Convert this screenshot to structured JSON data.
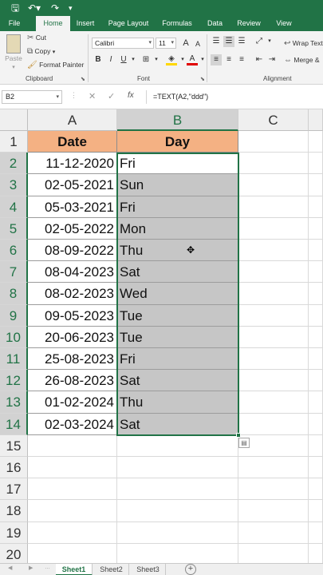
{
  "quick_access": {
    "save_icon": "save-icon",
    "undo_icon": "undo-icon",
    "redo_icon": "redo-icon",
    "customize_icon": "customize-icon"
  },
  "tabs": [
    "File",
    "Home",
    "Insert",
    "Page Layout",
    "Formulas",
    "Data",
    "Review",
    "View"
  ],
  "active_tab": "Home",
  "ribbon": {
    "clipboard": {
      "paste": "Paste",
      "cut": "Cut",
      "copy": "Copy",
      "format_painter": "Format Painter",
      "label": "Clipboard"
    },
    "font": {
      "name": "Calibri",
      "size": "11",
      "label": "Font",
      "bold": "B",
      "italic": "I",
      "underline": "U",
      "grow": "A",
      "shrink": "A",
      "fill_label": "A"
    },
    "alignment": {
      "wrap_text": "Wrap Text",
      "merge": "Merge &",
      "label": "Alignment"
    }
  },
  "formula_bar": {
    "name_box": "B2",
    "formula": "=TEXT(A2,\"ddd\")",
    "fx": "fx",
    "cancel": "✕",
    "enter": "✓"
  },
  "grid": {
    "columns": [
      "A",
      "B",
      "C"
    ],
    "rows": [
      "1",
      "2",
      "3",
      "4",
      "5",
      "6",
      "7",
      "8",
      "9",
      "10",
      "11",
      "12",
      "13",
      "14",
      "15",
      "16",
      "17",
      "18",
      "19",
      "20"
    ],
    "header": [
      "Date",
      "Day"
    ],
    "data": [
      [
        "11-12-2020",
        "Fri"
      ],
      [
        "02-05-2021",
        "Sun"
      ],
      [
        "05-03-2021",
        "Fri"
      ],
      [
        "02-05-2022",
        "Mon"
      ],
      [
        "08-09-2022",
        "Thu"
      ],
      [
        "08-04-2023",
        "Sat"
      ],
      [
        "08-02-2023",
        "Wed"
      ],
      [
        "09-05-2023",
        "Tue"
      ],
      [
        "20-06-2023",
        "Tue"
      ],
      [
        "25-08-2023",
        "Fri"
      ],
      [
        "26-08-2023",
        "Sat"
      ],
      [
        "01-02-2024",
        "Thu"
      ],
      [
        "02-03-2024",
        "Sat"
      ]
    ]
  },
  "sheets": [
    "Sheet1",
    "Sheet2",
    "Sheet3"
  ],
  "active_sheet": "Sheet1",
  "colors": {
    "accent": "#217346",
    "header_fill": "#f4b183",
    "selection_fill": "#c6c6c6"
  }
}
